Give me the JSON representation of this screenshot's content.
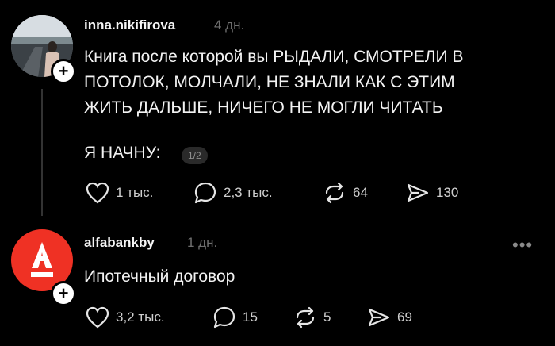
{
  "post1": {
    "username": "inna.nikifirova",
    "time": "4 дн.",
    "line1": "Книга после которой вы РЫДАЛИ, СМОТРЕЛИ В",
    "line2": "ПОТОЛОК, МОЛЧАЛИ, НЕ ЗНАЛИ КАК С ЭТИМ",
    "line3": "ЖИТЬ ДАЛЬШЕ, НИЧЕГО НЕ МОГЛИ ЧИТАТЬ",
    "line4": "Я НАЧНУ:",
    "badge": "1/2",
    "likes": "1 тыс.",
    "comments": "2,3 тыс.",
    "reposts": "64",
    "shares": "130",
    "plus": "+"
  },
  "post2": {
    "username": "alfabankby",
    "time": "1 дн.",
    "text": "Ипотечный договор",
    "likes": "3,2 тыс.",
    "comments": "15",
    "reposts": "5",
    "shares": "69",
    "plus": "+",
    "more": "•••"
  },
  "colors": {
    "background": "#000000",
    "alfa_red": "#ef3124",
    "muted": "#6f6f6f"
  },
  "icons": [
    "heart-icon",
    "comment-icon",
    "repost-icon",
    "share-icon",
    "plus-icon",
    "more-icon"
  ]
}
